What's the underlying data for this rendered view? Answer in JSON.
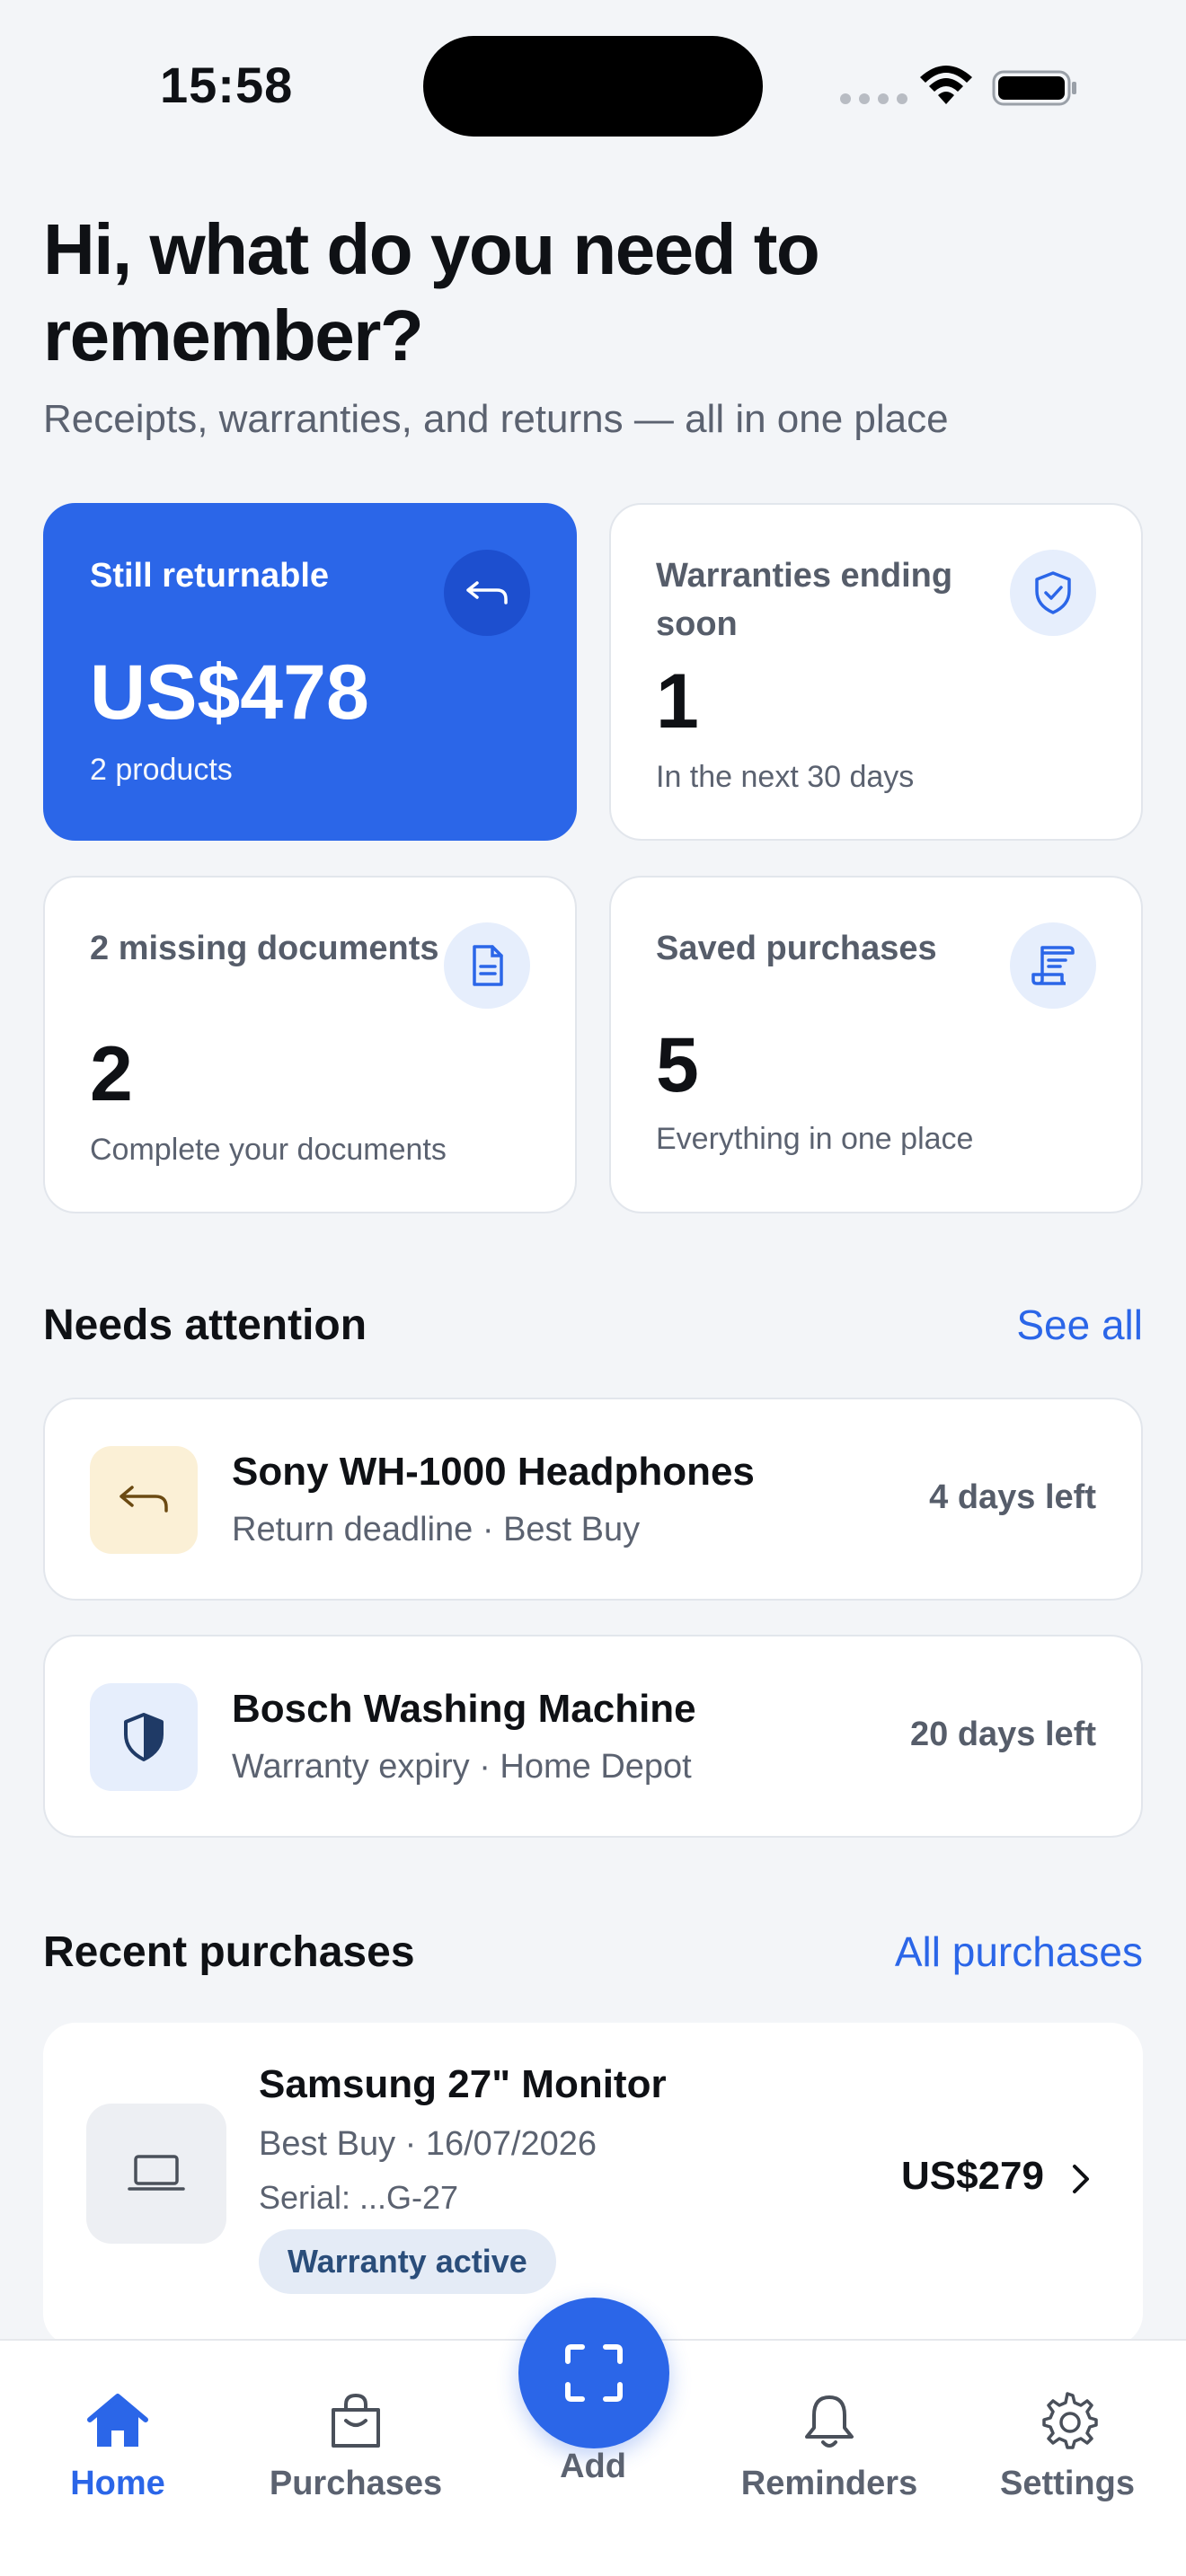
{
  "status_bar": {
    "time": "15:58"
  },
  "header": {
    "title": "Hi, what do you need to remember?",
    "subtitle": "Receipts, warranties, and returns — all in one place"
  },
  "summary_cards": {
    "returnable": {
      "label": "Still returnable",
      "value": "US$478",
      "note": "2 products",
      "icon": "return-arrow-icon"
    },
    "warranties": {
      "label": "Warranties ending soon",
      "value": "1",
      "note": "In the next 30 days",
      "icon": "shield-check-icon"
    },
    "documents": {
      "label": "2 missing documents",
      "value": "2",
      "note": "Complete your documents",
      "icon": "document-icon"
    },
    "saved": {
      "label": "Saved purchases",
      "value": "5",
      "note": "Everything in one place",
      "icon": "receipt-icon"
    }
  },
  "needs_attention": {
    "title": "Needs attention",
    "link": "See all",
    "items": [
      {
        "title": "Sony WH-1000 Headphones",
        "subtitle": "Return deadline · Best Buy",
        "days": "4 days left",
        "icon": "return-arrow-icon",
        "icon_bg": "#fbf0d6"
      },
      {
        "title": "Bosch Washing Machine",
        "subtitle": "Warranty expiry · Home Depot",
        "days": "20 days left",
        "icon": "shield-icon",
        "icon_bg": "#e6eefc"
      }
    ]
  },
  "recent_purchases": {
    "title": "Recent purchases",
    "link": "All purchases",
    "items": [
      {
        "title": "Samsung 27\" Monitor",
        "meta": "Best Buy · 16/07/2026",
        "serial": "Serial: ...G-27",
        "badge": "Warranty active",
        "price": "US$279",
        "icon": "laptop-icon"
      }
    ]
  },
  "tab_bar": {
    "home": "Home",
    "purchases": "Purchases",
    "add": "Add",
    "reminders": "Reminders",
    "settings": "Settings"
  },
  "colors": {
    "accent": "#2b66e8",
    "background": "#f3f5f8"
  }
}
